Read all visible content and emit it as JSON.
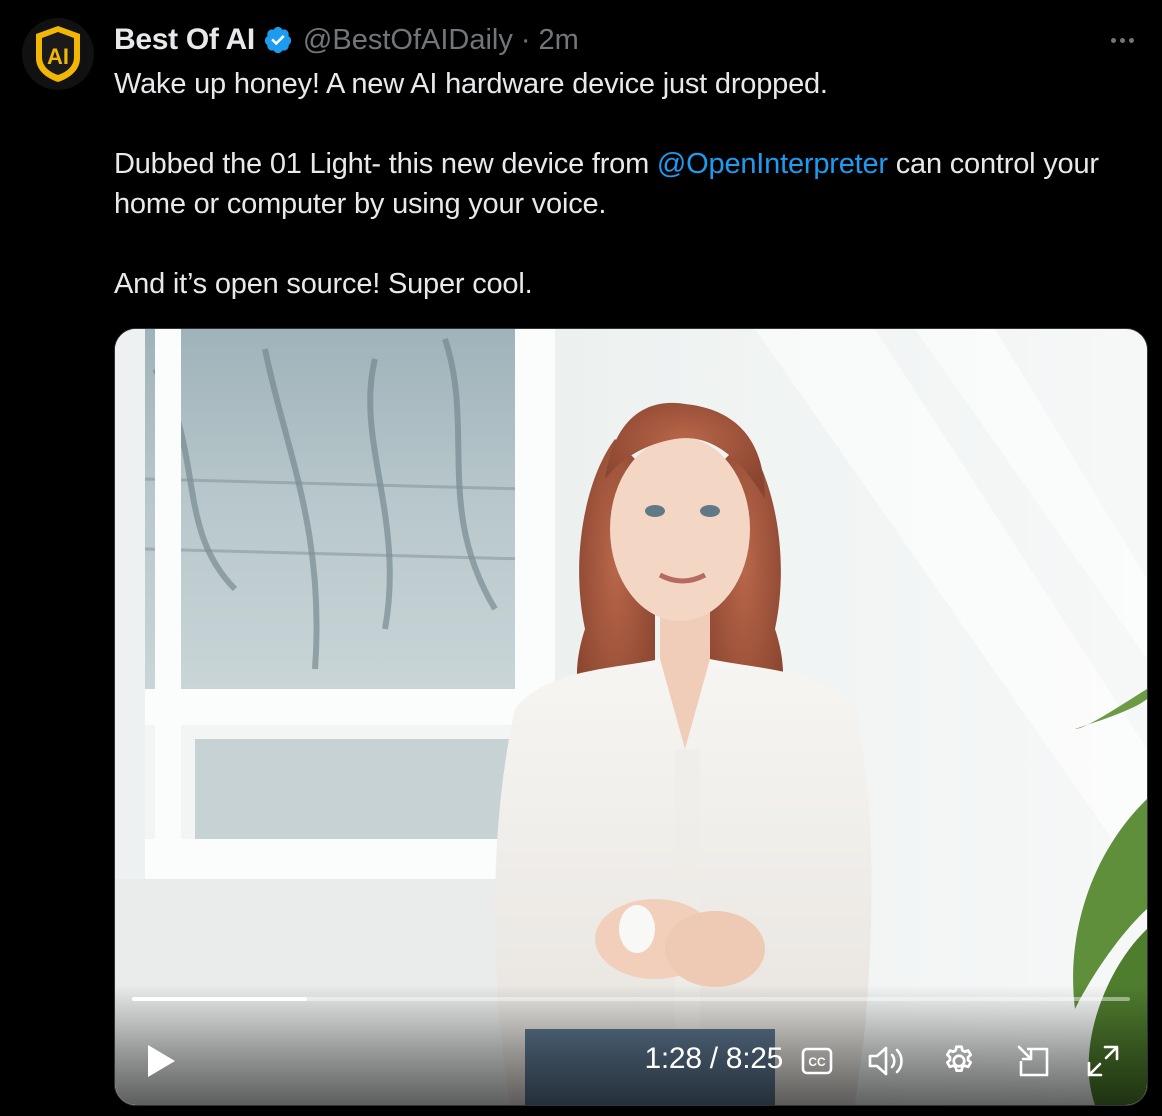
{
  "tweet": {
    "author_name": "Best Of AI",
    "handle": "@BestOfAIDaily",
    "separator": "·",
    "timestamp": "2m",
    "avatar_text": "AI",
    "text": {
      "line1": "Wake up honey! A new AI hardware device just dropped.",
      "para2_before": "Dubbed the 01 Light- this new device from ",
      "para2_mention": "@OpenInterpreter",
      "para2_after": " can control your home or computer by using your voice.",
      "para3": "And it’s open source! Super cool."
    }
  },
  "video": {
    "current_time": "1:28",
    "duration": "8:25",
    "time_display": "1:28 / 8:25",
    "progress_fraction": 0.175,
    "cc_label": "CC"
  },
  "colors": {
    "background": "#000000",
    "text_primary": "#e7e9ea",
    "text_secondary": "#71767b",
    "link": "#1d9bf0",
    "verified": "#1d9bf0",
    "avatar_gold": "#f2b705"
  },
  "icons": {
    "more": "more-horizontal-icon",
    "verified": "verified-badge-icon",
    "play": "play-icon",
    "captions": "closed-captions-icon",
    "volume": "volume-icon",
    "settings": "gear-icon",
    "pip": "picture-in-picture-icon",
    "fullscreen": "fullscreen-icon"
  }
}
